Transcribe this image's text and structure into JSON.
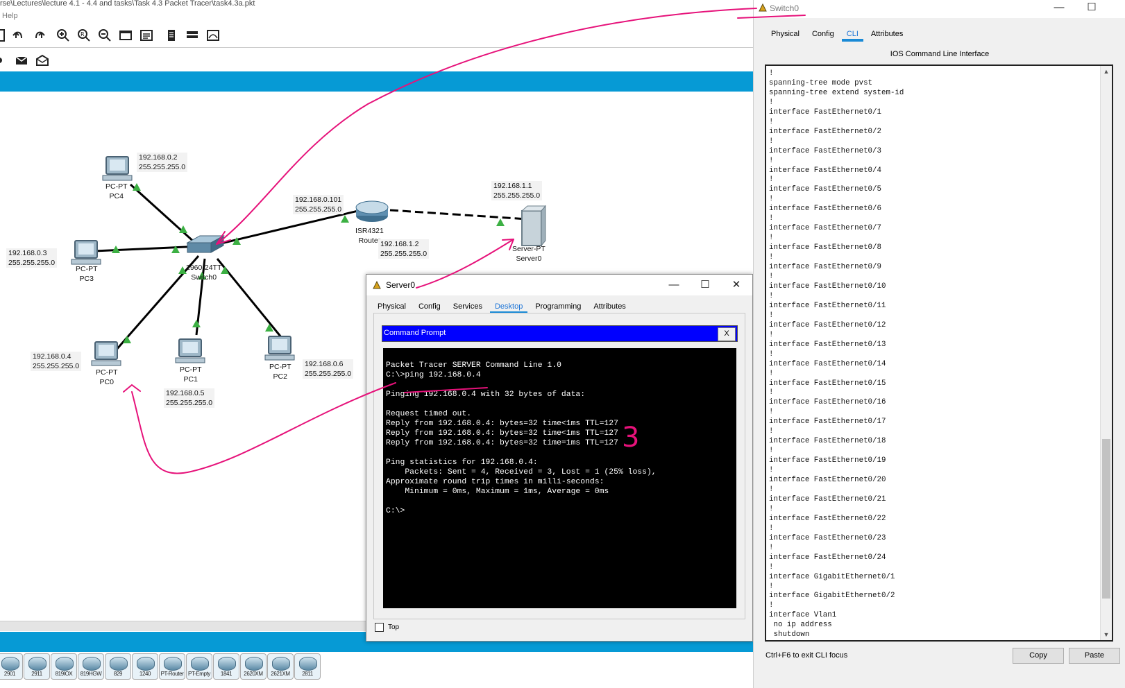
{
  "workspace": {
    "title_path": "rse\\Lectures\\lecture 4.1 - 4.4 and tasks\\Task 4.3 Packet Tracer\\task4.3a.pkt",
    "menu_help": "Help",
    "toolbar_icons": [
      "new-icon",
      "undo-icon",
      "redo-icon",
      "zoom-in-icon",
      "zoom-reset-icon",
      "zoom-out-icon",
      "drawing-palette-icon",
      "custom-device-dialog-icon",
      "pdu-list-icon",
      "cluster-icon",
      "viewport-icon"
    ],
    "toolbar2_icons": [
      "simple-pdu-icon",
      "complex-pdu-icon"
    ],
    "devices": {
      "pc4": {
        "type": "PC-PT",
        "name": "PC4",
        "ip": "192.168.0.2",
        "mask": "255.255.255.0"
      },
      "pc3": {
        "type": "PC-PT",
        "name": "PC3",
        "ip": "192.168.0.3",
        "mask": "255.255.255.0"
      },
      "pc0": {
        "type": "PC-PT",
        "name": "PC0",
        "ip": "192.168.0.4",
        "mask": "255.255.255.0"
      },
      "pc1": {
        "type": "PC-PT",
        "name": "PC1",
        "ip": "192.168.0.5",
        "mask": "255.255.255.0"
      },
      "pc2": {
        "type": "PC-PT",
        "name": "PC2",
        "ip": "192.168.0.6",
        "mask": "255.255.255.0"
      },
      "switch0": {
        "type": "2960-24TT",
        "name": "Switch0"
      },
      "router": {
        "type": "ISR4321",
        "name": "Router",
        "ip_lan": "192.168.0.101",
        "mask_lan": "255.255.255.0",
        "ip_wan": "192.168.1.2",
        "mask_wan": "255.255.255.0"
      },
      "server0": {
        "type": "Server-PT",
        "name": "Server0",
        "ip": "192.168.1.1",
        "mask": "255.255.255.0"
      }
    },
    "device_tray": [
      "2901",
      "2911",
      "819IOX",
      "819HGW",
      "829",
      "1240",
      "PT-Router",
      "PT-Empty",
      "1841",
      "2620XM",
      "2621XM",
      "2811"
    ]
  },
  "server_window": {
    "title": "Server0",
    "controls": {
      "minimize": "—",
      "maximize": "☐",
      "close": "✕"
    },
    "tabs": [
      "Physical",
      "Config",
      "Services",
      "Desktop",
      "Programming",
      "Attributes"
    ],
    "active_tab": "Desktop",
    "cmd_title": "Command Prompt",
    "cmd_close": "X",
    "cmd_output": "Packet Tracer SERVER Command Line 1.0\nC:\\>ping 192.168.0.4\n\nPinging 192.168.0.4 with 32 bytes of data:\n\nRequest timed out.\nReply from 192.168.0.4: bytes=32 time<1ms TTL=127\nReply from 192.168.0.4: bytes=32 time<1ms TTL=127\nReply from 192.168.0.4: bytes=32 time=1ms TTL=127\n\nPing statistics for 192.168.0.4:\n    Packets: Sent = 4, Received = 3, Lost = 1 (25% loss),\nApproximate round trip times in milli-seconds:\n    Minimum = 0ms, Maximum = 1ms, Average = 0ms\n\nC:\\>",
    "top_checkbox_label": "Top",
    "top_checked": false
  },
  "switch_window": {
    "title": "Switch0",
    "controls": {
      "minimize": "—",
      "maximize": "☐"
    },
    "tabs": [
      "Physical",
      "Config",
      "CLI",
      "Attributes"
    ],
    "active_tab": "CLI",
    "heading": "IOS Command Line Interface",
    "cli_output": "!\nspanning-tree mode pvst\nspanning-tree extend system-id\n!\ninterface FastEthernet0/1\n!\ninterface FastEthernet0/2\n!\ninterface FastEthernet0/3\n!\ninterface FastEthernet0/4\n!\ninterface FastEthernet0/5\n!\ninterface FastEthernet0/6\n!\ninterface FastEthernet0/7\n!\ninterface FastEthernet0/8\n!\ninterface FastEthernet0/9\n!\ninterface FastEthernet0/10\n!\ninterface FastEthernet0/11\n!\ninterface FastEthernet0/12\n!\ninterface FastEthernet0/13\n!\ninterface FastEthernet0/14\n!\ninterface FastEthernet0/15\n!\ninterface FastEthernet0/16\n!\ninterface FastEthernet0/17\n!\ninterface FastEthernet0/18\n!\ninterface FastEthernet0/19\n!\ninterface FastEthernet0/20\n!\ninterface FastEthernet0/21\n!\ninterface FastEthernet0/22\n!\ninterface FastEthernet0/23\n!\ninterface FastEthernet0/24\n!\ninterface GigabitEthernet0/1\n!\ninterface GigabitEthernet0/2\n!\ninterface Vlan1\n no ip address\n shutdown",
    "hint": "Ctrl+F6 to exit CLI focus",
    "copy_label": "Copy",
    "paste_label": "Paste"
  },
  "annotations": {
    "handwritten_digit": "3",
    "ink_color": "#e6127a"
  },
  "colors": {
    "accent_blue": "#069ad5",
    "link_up": "#3cb043",
    "tab_active": "#1a73d6"
  }
}
